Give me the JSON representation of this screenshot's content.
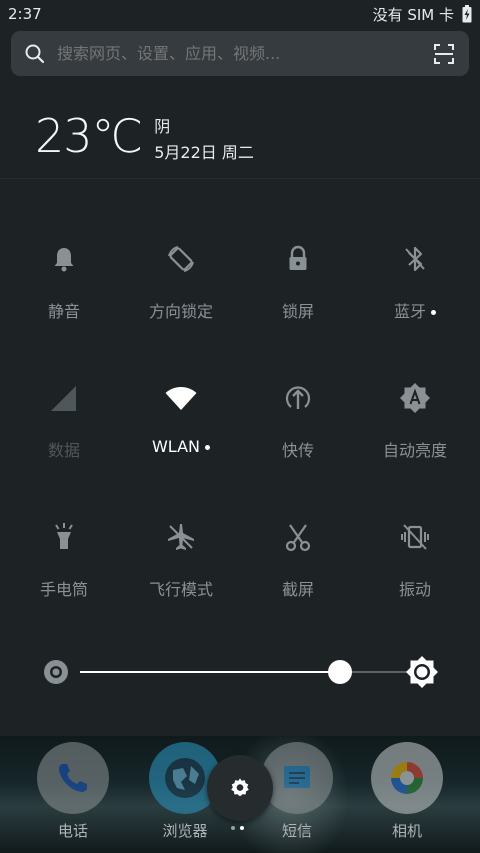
{
  "status_bar": {
    "time": "2:37",
    "sim": "没有 SIM 卡"
  },
  "search": {
    "placeholder": "搜索网页、设置、应用、视频..."
  },
  "weather": {
    "temperature": "23℃",
    "condition": "阴",
    "date": "5月22日 周二"
  },
  "tiles": [
    {
      "label": "静音",
      "icon": "bell-icon",
      "state": "off",
      "has_dot": false
    },
    {
      "label": "方向锁定",
      "icon": "rotation-lock-icon",
      "state": "off",
      "has_dot": false
    },
    {
      "label": "锁屏",
      "icon": "lock-icon",
      "state": "off",
      "has_dot": false
    },
    {
      "label": "蓝牙",
      "icon": "bluetooth-off-icon",
      "state": "off",
      "has_dot": true
    },
    {
      "label": "数据",
      "icon": "cellular-signal-icon",
      "state": "disabled",
      "has_dot": false
    },
    {
      "label": "WLAN",
      "icon": "wifi-icon",
      "state": "on",
      "has_dot": true
    },
    {
      "label": "快传",
      "icon": "share-upload-icon",
      "state": "off",
      "has_dot": false
    },
    {
      "label": "自动亮度",
      "icon": "auto-brightness-icon",
      "state": "off",
      "has_dot": false
    },
    {
      "label": "手电筒",
      "icon": "flashlight-icon",
      "state": "off",
      "has_dot": false
    },
    {
      "label": "飞行模式",
      "icon": "airplane-off-icon",
      "state": "off",
      "has_dot": false
    },
    {
      "label": "截屏",
      "icon": "scissors-icon",
      "state": "off",
      "has_dot": false
    },
    {
      "label": "振动",
      "icon": "vibrate-off-icon",
      "state": "off",
      "has_dot": false
    }
  ],
  "brightness": {
    "level": 0.73
  },
  "dock": {
    "apps": [
      {
        "label": "电话",
        "icon": "phone-icon"
      },
      {
        "label": "浏览器",
        "icon": "browser-globe-icon"
      },
      {
        "label": "短信",
        "icon": "messages-icon"
      },
      {
        "label": "相机",
        "icon": "camera-icon"
      }
    ],
    "settings_icon": "gear-icon"
  },
  "colors": {
    "background": "#1d2225",
    "search_bg": "#353b3f",
    "active": "#ffffff",
    "inactive": "#8a9195"
  }
}
